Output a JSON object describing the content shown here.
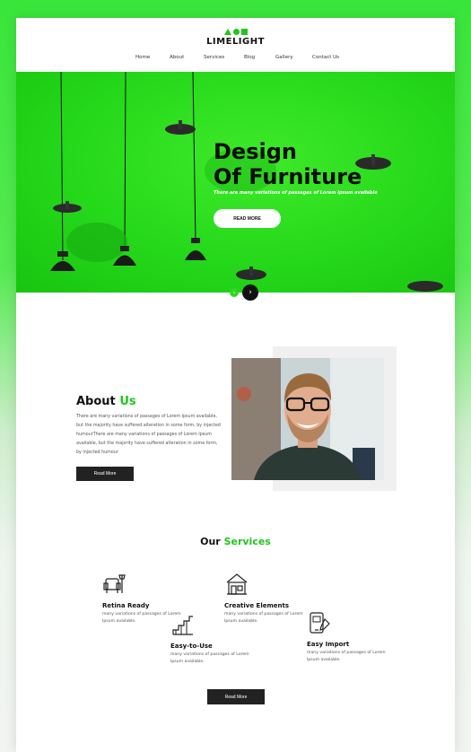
{
  "brand": {
    "name": "LIMELIGHT",
    "accent": "#22c41f"
  },
  "nav": {
    "items": [
      "Home",
      "About",
      "Services",
      "Blog",
      "Gallery",
      "Contact Us"
    ]
  },
  "hero": {
    "title_line1": "Design",
    "title_line2": "Of Furniture",
    "subtitle": "There are many variations of passages of Lorem Ipsum available",
    "cta": "READ MORE",
    "prev_icon": "chevron-left-icon",
    "next_icon": "chevron-right-icon"
  },
  "about": {
    "title_main": "About",
    "title_accent": "Us",
    "body": "There are many variations of passages of Lorem Ipsum available, but the majority have suffered alteration in some form, by injected humourThere are many variations of passages of Lorem Ipsum available, but the majority have suffered alteration in some form, by injected humour",
    "button": "Read More"
  },
  "services": {
    "title_main": "Our",
    "title_accent": "Services",
    "items": [
      {
        "name": "Retina Ready",
        "desc": "many variations of passages of Lorem Ipsum available.",
        "icon": "armchair-icon"
      },
      {
        "name": "Creative Elements",
        "desc": "many variations of passages of Lorem Ipsum available.",
        "icon": "store-icon"
      },
      {
        "name": "Easy-to-Use",
        "desc": "many variations of passages of Lorem Ipsum available.",
        "icon": "stairs-icon"
      },
      {
        "name": "Easy Import",
        "desc": "many variations of passages of Lorem Ipsum available.",
        "icon": "mobile-edit-icon"
      }
    ],
    "button": "Read More"
  }
}
